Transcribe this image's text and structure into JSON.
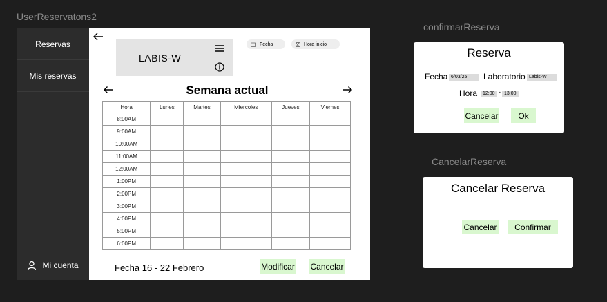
{
  "frames": {
    "main": "UserReservatons2",
    "confirm": "confirmarReserva",
    "cancel": "CancelarReserva"
  },
  "sidebar": {
    "items": [
      {
        "label": "Reservas"
      },
      {
        "label": "Mis reservas"
      }
    ],
    "account_label": "Mi cuenta"
  },
  "main": {
    "lab_name": "LABIS-W",
    "filters": {
      "date_label": "Fecha",
      "start_time_label": "Hora inicio"
    },
    "week_title": "Semana actual",
    "schedule": {
      "headers": [
        "Hora",
        "Lunes",
        "Martes",
        "Miercoles",
        "Jueves",
        "Viernes"
      ],
      "hours": [
        "8:00AM",
        "9:00AM",
        "10:00AM",
        "11:00AM",
        "12:00AM",
        "1:00PM",
        "2:00PM",
        "3:00PM",
        "4:00PM",
        "5:00PM",
        "6:00PM"
      ]
    },
    "date_range": "Fecha 16 - 22 Febrero",
    "modify_label": "Modificar",
    "cancel_label": "Cancelar"
  },
  "confirm_dialog": {
    "title": "Reserva",
    "date_label": "Fecha",
    "date_value": "6/03/25",
    "lab_label": "Laboratorio",
    "lab_value": "Labis-W",
    "time_label": "Hora",
    "start_time": "12:00",
    "separator": "-",
    "end_time": "13:00",
    "cancel_label": "Cancelar",
    "ok_label": "Ok"
  },
  "cancel_dialog": {
    "title": "Cancelar Reserva",
    "cancel_label": "Cancelar",
    "confirm_label": "Confirmar"
  },
  "colors": {
    "background": "#1e1e1e",
    "sidebar": "#2c2c2c",
    "accent_button": "#d9f7cf",
    "card": "#e4e4e4"
  }
}
